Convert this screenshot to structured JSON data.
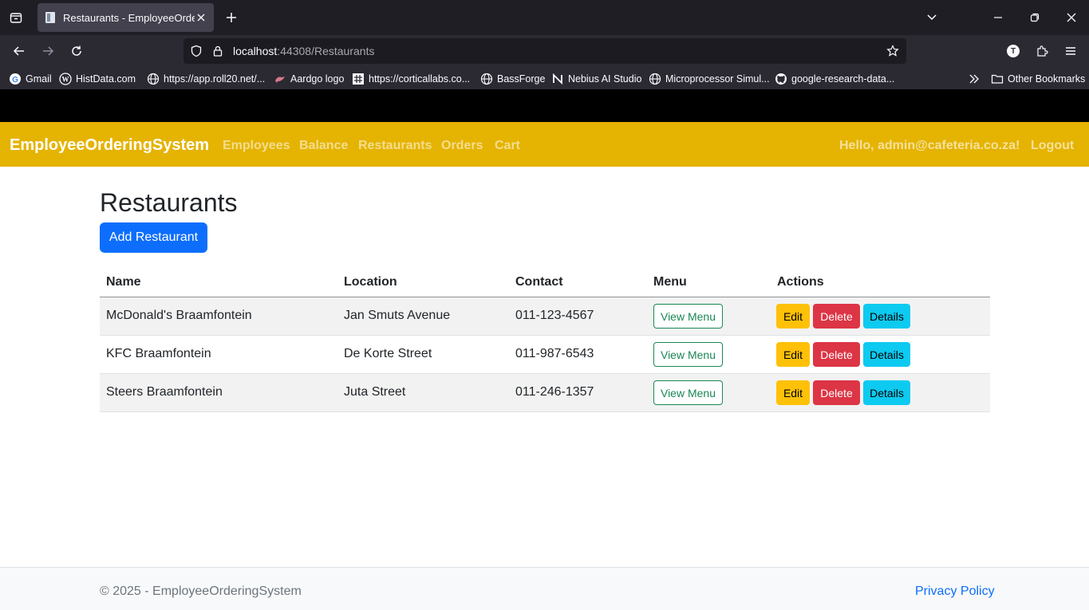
{
  "browser": {
    "tab_title": "Restaurants - EmployeeOrderingSystem",
    "url_host": "localhost",
    "url_path": ":44308/Restaurants",
    "bookmarks": [
      {
        "label": "Gmail",
        "icon": "google-icon"
      },
      {
        "label": "HistData.com",
        "icon": "wordpress-icon"
      },
      {
        "label": "https://app.roll20.net/...",
        "icon": "globe-icon"
      },
      {
        "label": "Aardgo logo",
        "icon": "aardvark-icon"
      },
      {
        "label": "https://corticallabs.co...",
        "icon": "hash-icon"
      },
      {
        "label": "BassForge",
        "icon": "globe-icon"
      },
      {
        "label": "Nebius AI Studio",
        "icon": "nebius-icon"
      },
      {
        "label": "Microprocessor Simul...",
        "icon": "globe-icon"
      },
      {
        "label": "google-research-data...",
        "icon": "github-icon"
      }
    ],
    "other_bookmarks": "Other Bookmarks",
    "profile_initial": "T"
  },
  "app": {
    "brand": "EmployeeOrderingSystem",
    "nav": [
      "Employees",
      "Balance",
      "Restaurants",
      "Orders",
      "Cart"
    ],
    "greeting": "Hello, admin@cafeteria.co.za!",
    "logout": "Logout",
    "accent_color": "#e5b301"
  },
  "page": {
    "title": "Restaurants",
    "add_button": "Add Restaurant",
    "columns": [
      "Name",
      "Location",
      "Contact",
      "Menu",
      "Actions"
    ],
    "rows": [
      {
        "name": "McDonald's Braamfontein",
        "location": "Jan Smuts Avenue",
        "contact": "011-123-4567"
      },
      {
        "name": "KFC Braamfontein",
        "location": "De Korte Street",
        "contact": "011-987-6543"
      },
      {
        "name": "Steers Braamfontein",
        "location": "Juta Street",
        "contact": "011-246-1357"
      }
    ],
    "view_menu_label": "View Menu",
    "edit_label": "Edit",
    "delete_label": "Delete",
    "details_label": "Details"
  },
  "footer": {
    "copyright": "© 2025 - EmployeeOrderingSystem",
    "privacy": "Privacy Policy"
  }
}
